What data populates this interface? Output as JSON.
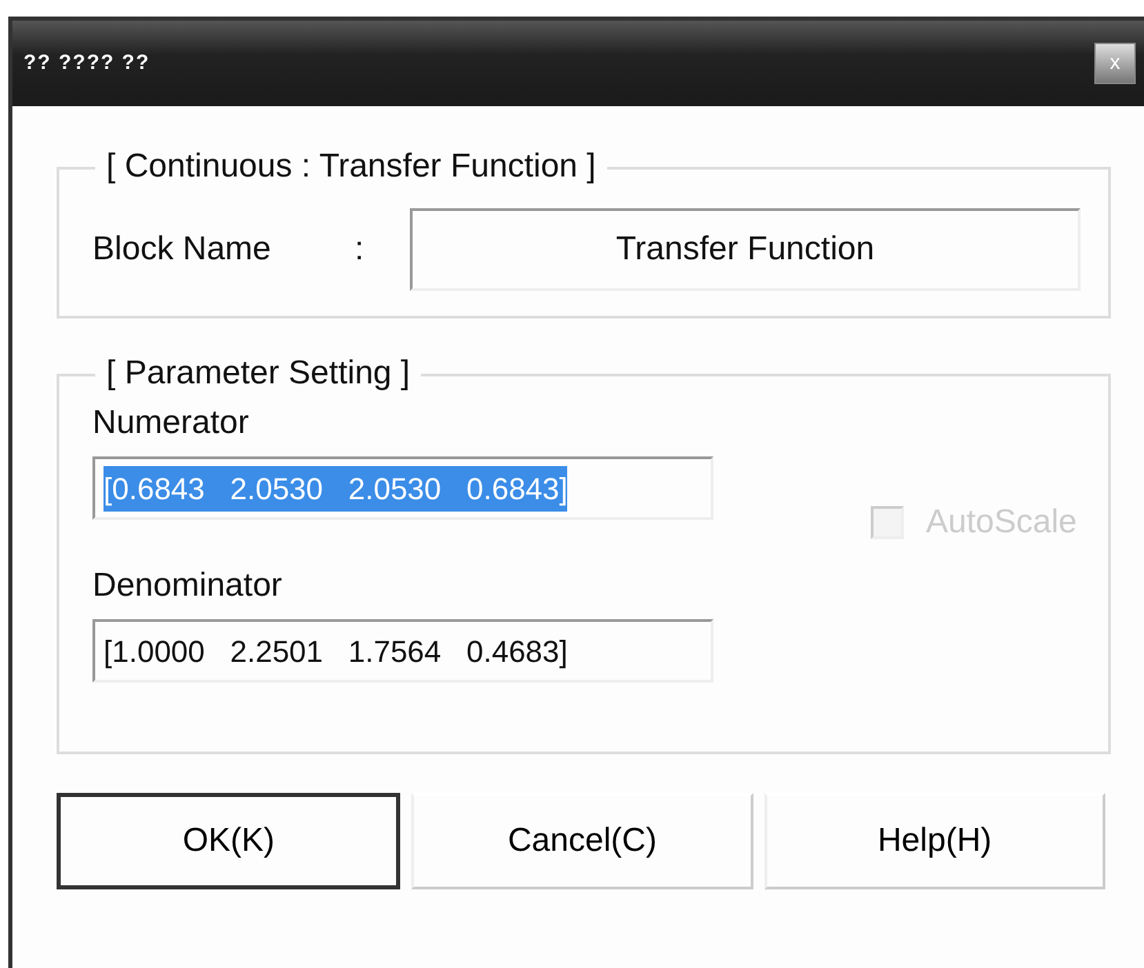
{
  "window": {
    "title": "?? ???? ??",
    "close": "x"
  },
  "block_group": {
    "title": "[ Continuous : Transfer Function ]",
    "label": "Block Name",
    "separator": ":",
    "value": "Transfer Function"
  },
  "parameter_group": {
    "title": "[ Parameter Setting ]",
    "fields": [
      {
        "label": "Numerator",
        "value": "[0.6843   2.0530   2.0530   0.6843]",
        "selected": true
      },
      {
        "label": "Denominator",
        "value": "[1.0000   2.2501   1.7564   0.4683]",
        "selected": false
      }
    ],
    "autoscale": {
      "label": "AutoScale",
      "checked": false,
      "disabled": true
    }
  },
  "buttons": [
    {
      "label": "OK(K)",
      "default": true
    },
    {
      "label": "Cancel(C)",
      "default": false
    },
    {
      "label": "Help(H)",
      "default": false
    }
  ]
}
